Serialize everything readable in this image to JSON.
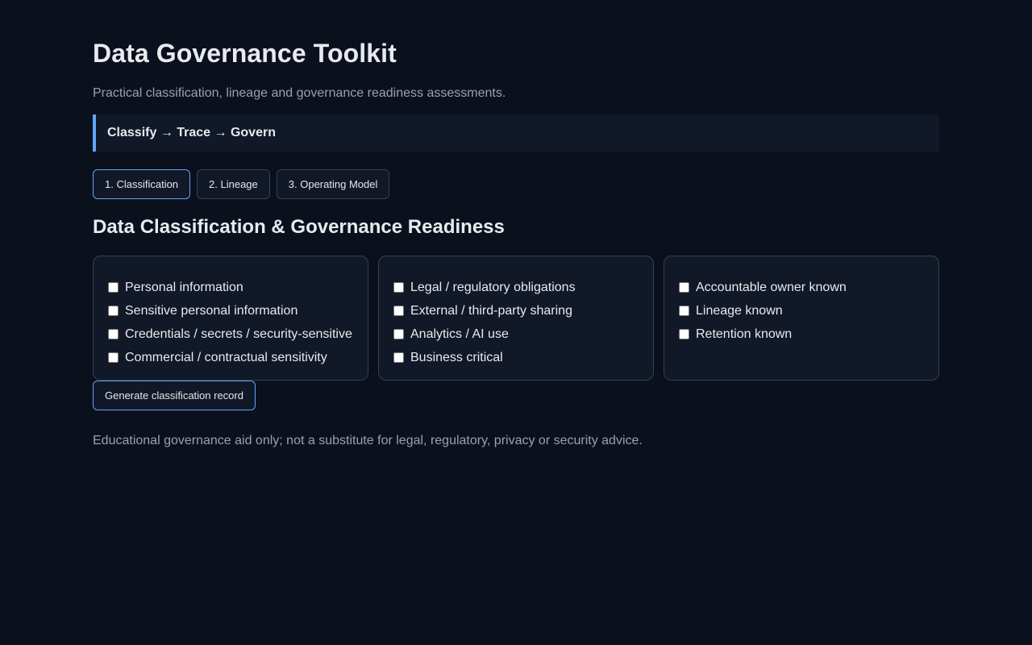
{
  "header": {
    "title": "Data Governance Toolkit",
    "subtitle": "Practical classification, lineage and governance readiness assessments.",
    "banner": "Classify → Trace → Govern"
  },
  "tabs": [
    {
      "label": "1. Classification",
      "active": true
    },
    {
      "label": "2. Lineage",
      "active": false
    },
    {
      "label": "3. Operating Model",
      "active": false
    }
  ],
  "section": {
    "title": "Data Classification & Governance Readiness"
  },
  "cards": [
    {
      "items": [
        {
          "label": "Personal information",
          "checked": false
        },
        {
          "label": "Sensitive personal information",
          "checked": false
        },
        {
          "label": "Credentials / secrets / security-sensitive",
          "checked": false
        },
        {
          "label": "Commercial / contractual sensitivity",
          "checked": false
        }
      ]
    },
    {
      "items": [
        {
          "label": "Legal / regulatory obligations",
          "checked": false
        },
        {
          "label": "External / third-party sharing",
          "checked": false
        },
        {
          "label": "Analytics / AI use",
          "checked": false
        },
        {
          "label": "Business critical",
          "checked": false
        }
      ]
    },
    {
      "items": [
        {
          "label": "Accountable owner known",
          "checked": false
        },
        {
          "label": "Lineage known",
          "checked": false
        },
        {
          "label": "Retention known",
          "checked": false
        }
      ]
    }
  ],
  "actions": {
    "generate_label": "Generate classification record"
  },
  "footer": {
    "disclaimer": "Educational governance aid only; not a substitute for legal, regulatory, privacy or security advice."
  },
  "colors": {
    "background": "#0b101d",
    "card": "#111827",
    "accent": "#60a5fa",
    "muted_text": "#9aa1ad"
  }
}
